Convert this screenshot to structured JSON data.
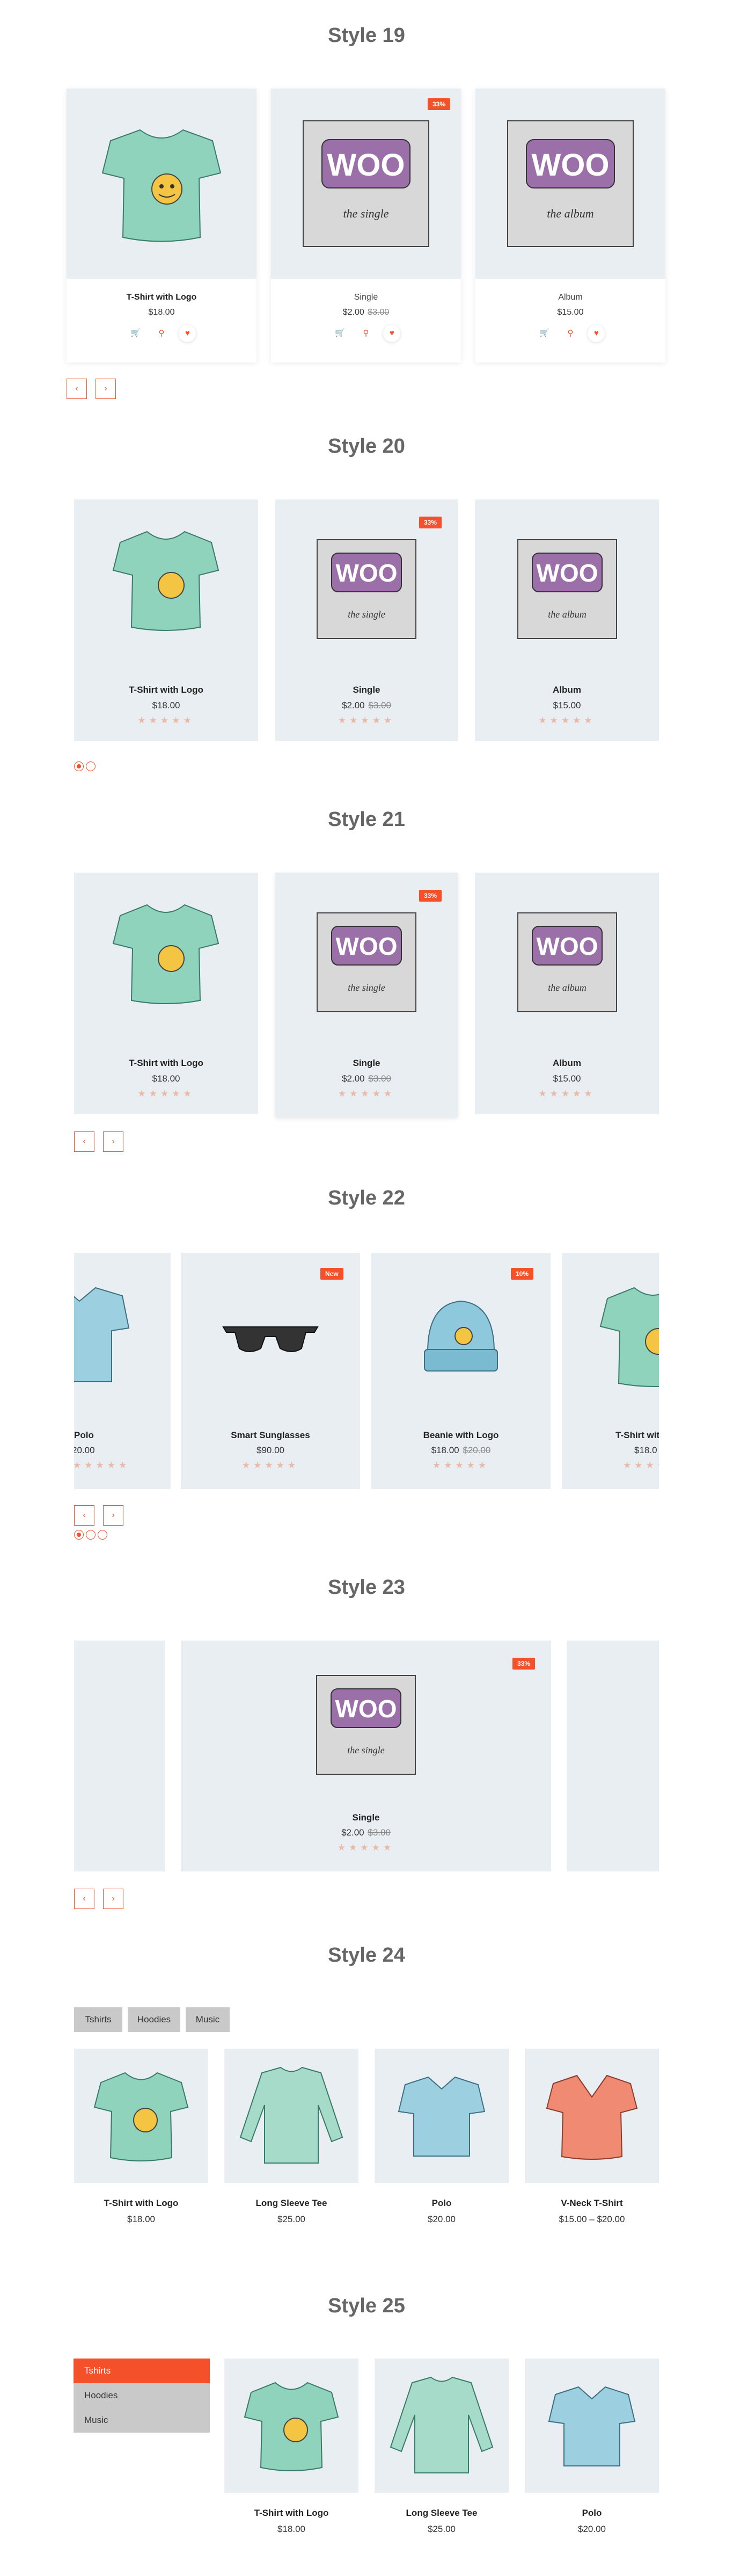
{
  "accent": "#f4502a",
  "styles": {
    "s19": "Style 19",
    "s20": "Style 20",
    "s21": "Style 21",
    "s22": "Style 22",
    "s23": "Style 23",
    "s24": "Style 24",
    "s25": "Style 25"
  },
  "products": {
    "tshirt": {
      "name": "T-Shirt with Logo",
      "price": "$18.00"
    },
    "single": {
      "name": "Single",
      "price": "$2.00",
      "old": "$3.00",
      "badge": "33%"
    },
    "album": {
      "name": "Album",
      "price": "$15.00"
    },
    "polo": {
      "name": "Polo",
      "price": "$20.00",
      "price_partial": "20.00",
      "name_partial": "Polo"
    },
    "sunglasses": {
      "name": "Smart Sunglasses",
      "price": "$90.00",
      "badge": "New"
    },
    "beanie": {
      "name": "Beanie with Logo",
      "price": "$18.00",
      "old": "$20.00",
      "badge": "10%"
    },
    "tshirt_partial": {
      "name": "T-Shirt wit",
      "price": "$18.0"
    },
    "longsleeve": {
      "name": "Long Sleeve Tee",
      "price": "$25.00"
    },
    "vneck": {
      "name": "V-Neck T-Shirt",
      "price": "$15.00 – $20.00"
    }
  },
  "woo": {
    "logo": "WOO",
    "single_script": "the single",
    "album_script": "the album"
  },
  "stars": "★★★★★",
  "nav": {
    "prev": "‹",
    "next": "›"
  },
  "icons": {
    "cart": "🛒",
    "search": "🔍",
    "heart": "♥"
  },
  "tabs24": [
    "Tshirts",
    "Hoodies",
    "Music"
  ],
  "tabs25": [
    "Tshirts",
    "Hoodies",
    "Music"
  ]
}
